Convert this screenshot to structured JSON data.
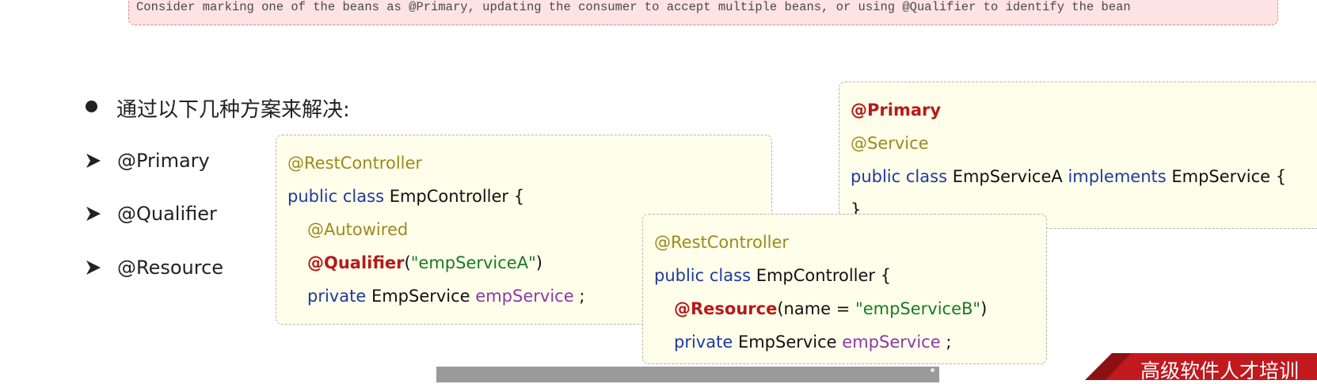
{
  "error_message": "Consider marking one of the beans as @Primary, updating the consumer to accept multiple beans, or using @Qualifier to identify the bean",
  "heading": "通过以下几种方案来解决:",
  "options": [
    "@Primary",
    "@Qualifier",
    "@Resource"
  ],
  "code_primary": {
    "annotation1": "@Primary",
    "annotation2": "@Service",
    "public": "public",
    "class": "class",
    "class_name": "EmpServiceA",
    "implements": "implements",
    "interface": "EmpService {",
    "close_brace": "}"
  },
  "code_qualifier": {
    "annotation": "@RestController",
    "public": "public",
    "class": "class",
    "class_name": "EmpController {",
    "autowired": "@Autowired",
    "qualifier": "@Qualifier",
    "paren_open": "(",
    "qualifier_value": "\"empServiceA\"",
    "paren_close": ")",
    "private": "private",
    "type": "EmpService",
    "field": "empService",
    "semicolon": ";"
  },
  "code_resource": {
    "annotation": "@RestController",
    "public": "public",
    "class": "class",
    "class_name": "EmpController {",
    "resource": "@Resource",
    "param_open": "(name = ",
    "resource_value": "\"empServiceB\"",
    "paren_close": ")",
    "private": "private",
    "type": "EmpService",
    "field": "empService",
    "semicolon": ";"
  },
  "banner_text": "高级软件人才培训",
  "colors": {
    "annotation": "#9b8a1a",
    "keyword": "#1d3aa0",
    "highlight": "#b51a1a",
    "string": "#177a23",
    "field": "#8a3aa8",
    "banner": "#c0191e"
  }
}
